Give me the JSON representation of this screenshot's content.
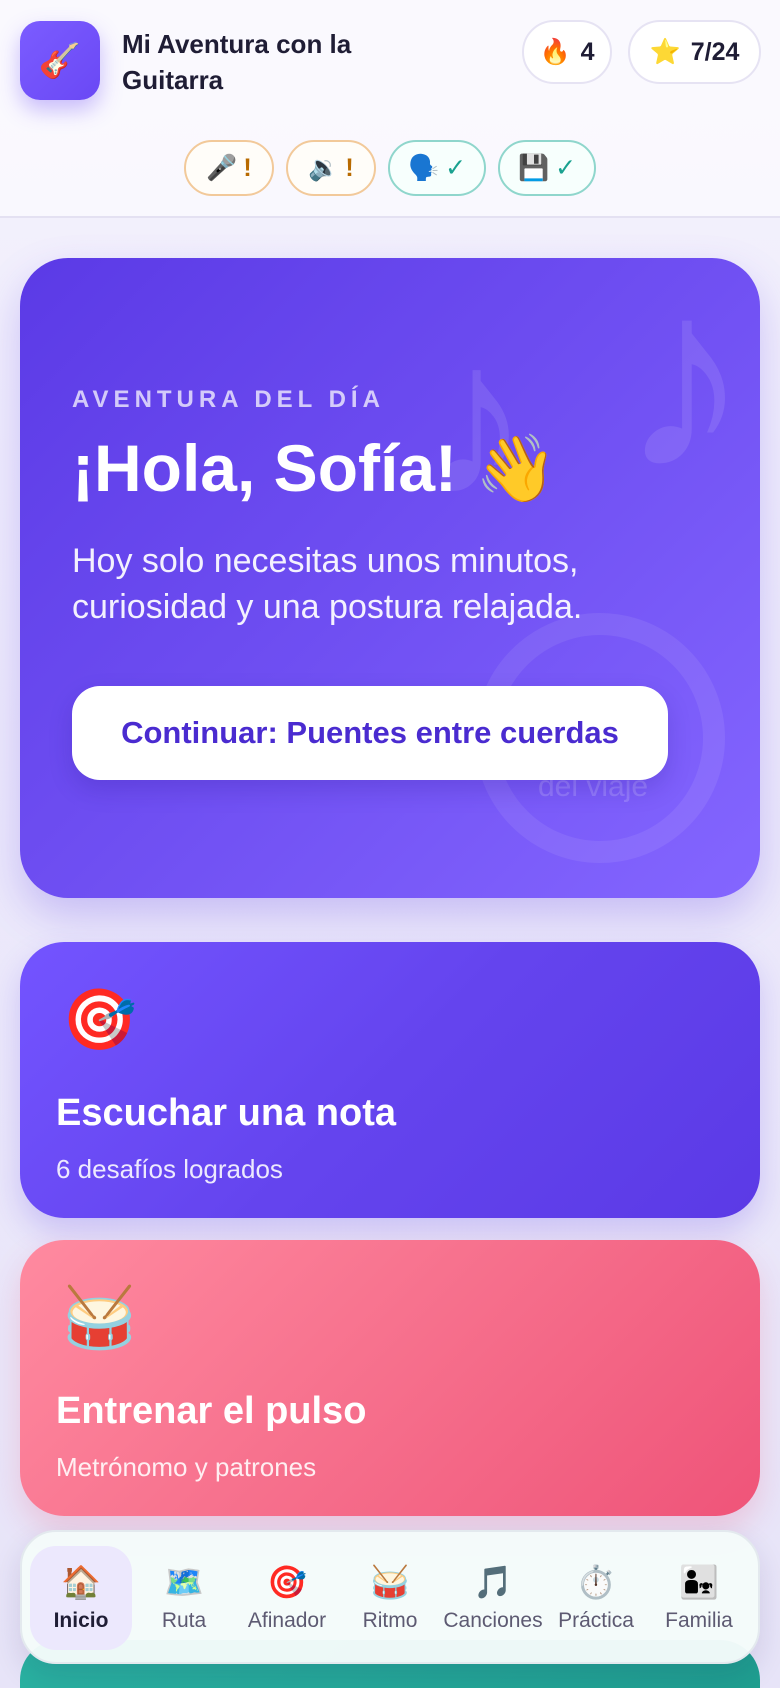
{
  "header": {
    "logo_icon": "🎸",
    "title": "Mi Aventura con la Guitarra",
    "streak": {
      "icon": "🔥",
      "value": "4"
    },
    "stars": {
      "icon": "⭐",
      "value": "7/24"
    },
    "status_chips": [
      {
        "icon": "🎤",
        "mark": "!",
        "state": "warning"
      },
      {
        "icon": "🔉",
        "mark": "!",
        "state": "warning"
      },
      {
        "icon": "🗣️",
        "mark": "✓",
        "state": "ok"
      },
      {
        "icon": "💾",
        "mark": "✓",
        "state": "ok"
      }
    ]
  },
  "hero": {
    "kicker": "AVENTURA DEL DÍA",
    "title": "¡Hola, Sofía! 👋",
    "text": "Hoy solo necesitas unos minutos, curiosidad y una postura relajada.",
    "button_label": "Continuar: Puentes entre cuerdas",
    "ring_label": "del viaje"
  },
  "cards": [
    {
      "icon": "🎯",
      "title": "Escuchar una nota",
      "subtitle": "6 desafíos logrados"
    },
    {
      "icon": "🥁",
      "title": "Entrenar el pulso",
      "subtitle": "Metrónomo y patrones"
    }
  ],
  "nav": [
    {
      "icon": "🏠",
      "label": "Inicio",
      "active": true
    },
    {
      "icon": "🗺️",
      "label": "Ruta"
    },
    {
      "icon": "🎯",
      "label": "Afinador"
    },
    {
      "icon": "🥁",
      "label": "Ritmo"
    },
    {
      "icon": "🎵",
      "label": "Canciones"
    },
    {
      "icon": "⏱️",
      "label": "Práctica"
    },
    {
      "icon": "👨‍👧",
      "label": "Familia"
    }
  ],
  "colors": {
    "accent": "#6a48f5",
    "hero_gradient_start": "#5b3ae6",
    "pink_card": "#f66f8c",
    "ok": "#1aa290",
    "warning": "#b86a00"
  }
}
